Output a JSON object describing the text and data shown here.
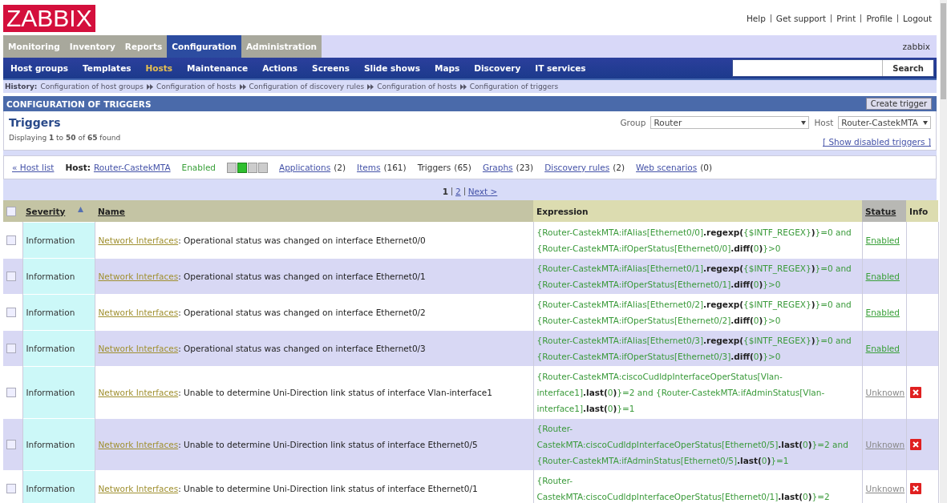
{
  "logo": "ZABBIX",
  "top_links": [
    "Help",
    "Get support",
    "Print",
    "Profile",
    "Logout"
  ],
  "main_tabs": [
    {
      "label": "Monitoring",
      "selected": false
    },
    {
      "label": "Inventory",
      "selected": false
    },
    {
      "label": "Reports",
      "selected": false
    },
    {
      "label": "Configuration",
      "selected": true
    },
    {
      "label": "Administration",
      "selected": false
    }
  ],
  "user": "zabbix",
  "sub_menu": [
    {
      "label": "Host groups",
      "selected": false
    },
    {
      "label": "Templates",
      "selected": false
    },
    {
      "label": "Hosts",
      "selected": true
    },
    {
      "label": "Maintenance",
      "selected": false
    },
    {
      "label": "Actions",
      "selected": false
    },
    {
      "label": "Screens",
      "selected": false
    },
    {
      "label": "Slide shows",
      "selected": false
    },
    {
      "label": "Maps",
      "selected": false
    },
    {
      "label": "Discovery",
      "selected": false
    },
    {
      "label": "IT services",
      "selected": false
    }
  ],
  "search_button": "Search",
  "history": {
    "label": "History:",
    "items": [
      "Configuration of host groups",
      "Configuration of hosts",
      "Configuration of discovery rules",
      "Configuration of hosts",
      "Configuration of triggers"
    ]
  },
  "section_title": "CONFIGURATION OF TRIGGERS",
  "create_button": "Create trigger",
  "title": "Triggers",
  "displaying": "Displaying **1** to **50** of **65** found",
  "group_filter": {
    "label": "Group",
    "value": "Router"
  },
  "host_filter": {
    "label": "Host",
    "value": "Router-CastekMTA"
  },
  "show_disabled": "[ Show disabled triggers ]",
  "host_bar": {
    "back": "« Host list",
    "host_label": "Host:",
    "host": "Router-CastekMTA",
    "status": "Enabled",
    "availability": [
      {
        "on": false
      },
      {
        "on": true
      },
      {
        "on": false
      },
      {
        "on": false
      }
    ],
    "links": [
      {
        "label": "Applications",
        "count": "(2)",
        "selected": false
      },
      {
        "label": "Items",
        "count": "(161)",
        "selected": false
      },
      {
        "label": "Triggers",
        "count": "(65)",
        "selected": true
      },
      {
        "label": "Graphs",
        "count": "(23)",
        "selected": false
      },
      {
        "label": "Discovery rules",
        "count": "(2)",
        "selected": false
      },
      {
        "label": "Web scenarios",
        "count": "(0)",
        "selected": false
      }
    ]
  },
  "pagination": [
    {
      "label": "1",
      "selected": true
    },
    {
      "label": "2",
      "selected": false
    },
    {
      "label": "Next >",
      "selected": false
    }
  ],
  "table": {
    "select_all": {
      "checked": false
    },
    "columns": [
      "Severity",
      "Name",
      "Expression",
      "Status",
      "Info"
    ],
    "rows": [
      {
        "checked": false,
        "severity": "Information",
        "app": "Network Interfaces",
        "description": ": Operational status was changed on interface Ethernet0/0",
        "expression": "{Router-CastekMTA:ifAlias[Ethernet0/0]**.regexp(**{$INTF_REGEX}**)**}=0 and {Router-CastekMTA:ifOperStatus[Ethernet0/0]**.diff(**0**)**}>0",
        "status": "Enabled",
        "enabled": true,
        "error": false
      },
      {
        "checked": false,
        "severity": "Information",
        "app": "Network Interfaces",
        "description": ": Operational status was changed on interface Ethernet0/1",
        "expression": "{Router-CastekMTA:ifAlias[Ethernet0/1]**.regexp(**{$INTF_REGEX}**)**}=0 and {Router-CastekMTA:ifOperStatus[Ethernet0/1]**.diff(**0**)**}>0",
        "status": "Enabled",
        "enabled": true,
        "error": false
      },
      {
        "checked": false,
        "severity": "Information",
        "app": "Network Interfaces",
        "description": ": Operational status was changed on interface Ethernet0/2",
        "expression": "{Router-CastekMTA:ifAlias[Ethernet0/2]**.regexp(**{$INTF_REGEX}**)**}=0 and {Router-CastekMTA:ifOperStatus[Ethernet0/2]**.diff(**0**)**}>0",
        "status": "Enabled",
        "enabled": true,
        "error": false
      },
      {
        "checked": false,
        "severity": "Information",
        "app": "Network Interfaces",
        "description": ": Operational status was changed on interface Ethernet0/3",
        "expression": "{Router-CastekMTA:ifAlias[Ethernet0/3]**.regexp(**{$INTF_REGEX}**)**}=0 and {Router-CastekMTA:ifOperStatus[Ethernet0/3]**.diff(**0**)**}>0",
        "status": "Enabled",
        "enabled": true,
        "error": false
      },
      {
        "checked": false,
        "severity": "Information",
        "app": "Network Interfaces",
        "description": ": Unable to determine Uni-Direction link status of interface Vlan-interface1",
        "expression": "{Router-CastekMTA:ciscoCudldpInterfaceOperStatus[Vlan-interface1]**.last(**0**)**}=2 and {Router-CastekMTA:ifAdminStatus[Vlan-interface1]**.last(**0**)**}=1",
        "status": "Unknown",
        "enabled": false,
        "error": true
      },
      {
        "checked": false,
        "severity": "Information",
        "app": "Network Interfaces",
        "description": ": Unable to determine Uni-Direction link status of interface Ethernet0/5",
        "expression": "{Router-CastekMTA:ciscoCudldpInterfaceOperStatus[Ethernet0/5]**.last(**0**)**}=2 and {Router-CastekMTA:ifAdminStatus[Ethernet0/5]**.last(**0**)**}=1",
        "status": "Unknown",
        "enabled": false,
        "error": true
      },
      {
        "checked": false,
        "severity": "Information",
        "app": "Network Interfaces",
        "description": ": Unable to determine Uni-Direction link status of interface Ethernet0/1",
        "expression": "{Router-CastekMTA:ciscoCudldpInterfaceOperStatus[Ethernet0/1]**.last(**0**)**}=2",
        "status": "Unknown",
        "enabled": false,
        "error": true
      }
    ]
  }
}
